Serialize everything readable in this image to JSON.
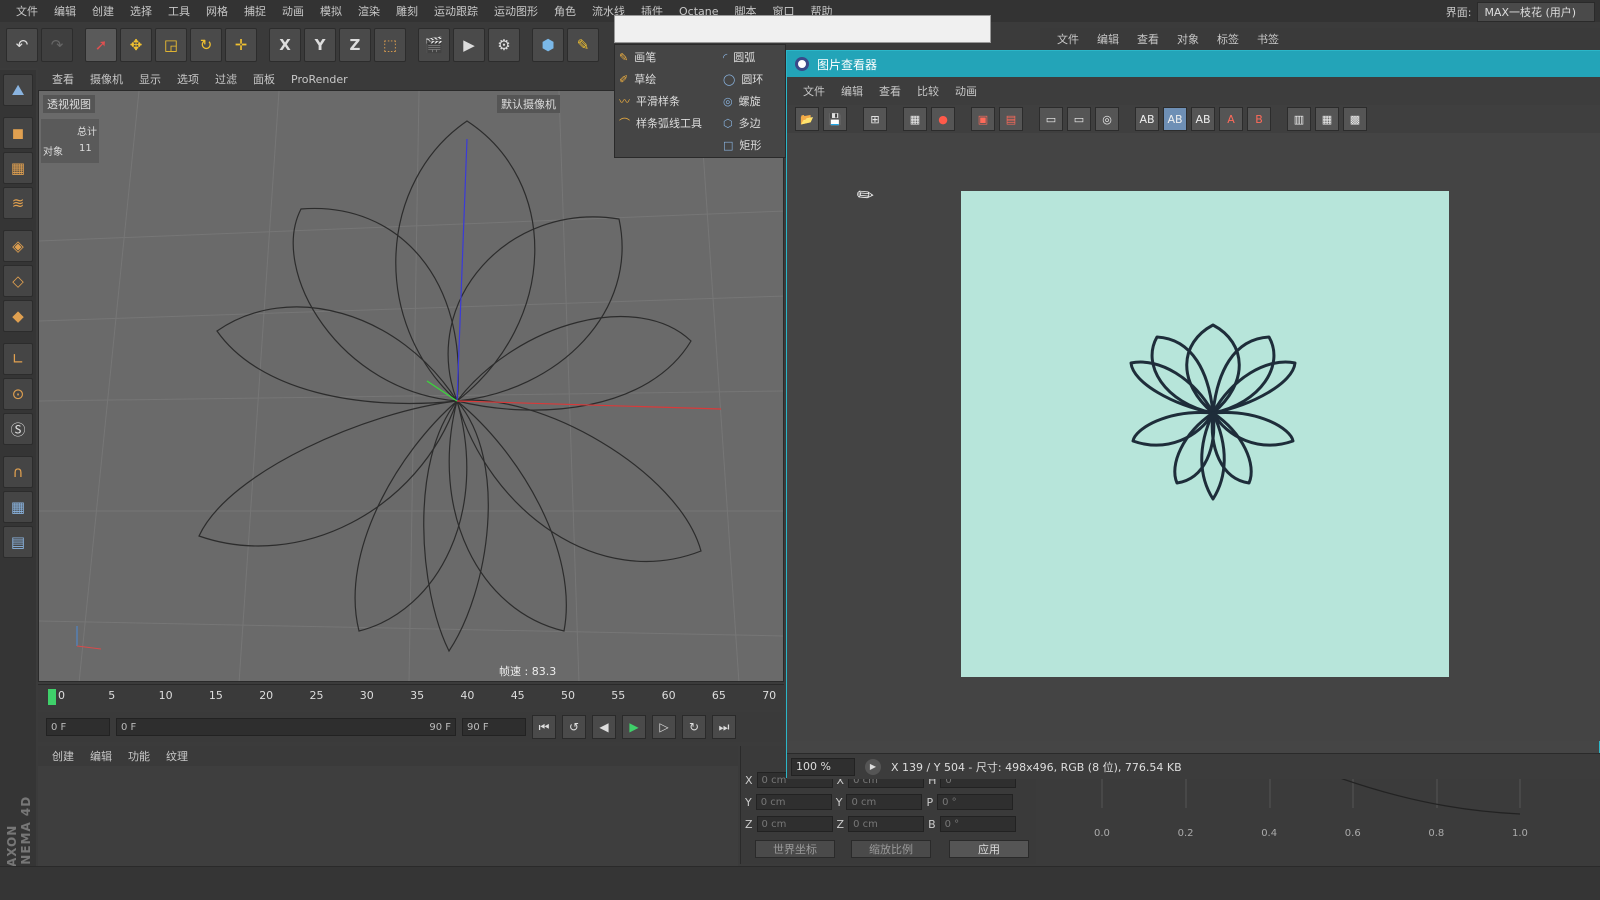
{
  "menubar": {
    "items": [
      "文件",
      "编辑",
      "创建",
      "选择",
      "工具",
      "网格",
      "捕捉",
      "动画",
      "模拟",
      "渲染",
      "雕刻",
      "运动跟踪",
      "运动图形",
      "角色",
      "流水线",
      "插件",
      "Octane",
      "脚本",
      "窗口",
      "帮助"
    ],
    "layout_label": "界面:",
    "layout_value": "MAX一枝花 (用户)"
  },
  "toolbar": {
    "axis_x": "X",
    "axis_y": "Y",
    "axis_z": "Z"
  },
  "viewport": {
    "menu": [
      "查看",
      "摄像机",
      "显示",
      "选项",
      "过滤",
      "面板",
      "ProRender"
    ],
    "label": "透视视图",
    "camera": "默认摄像机",
    "stats_total": "总计",
    "stats_objects_label": "对象",
    "stats_objects_value": "11",
    "speed": "帧速 : 83.3"
  },
  "spline_menu": {
    "left": [
      "画笔",
      "草绘",
      "平滑样条",
      "样条弧线工具"
    ],
    "right": [
      "圆弧",
      "圆环",
      "螺旋",
      "多边",
      "矩形"
    ]
  },
  "timeline": {
    "ticks": [
      "0",
      "5",
      "10",
      "15",
      "20",
      "25",
      "30",
      "35",
      "40",
      "45",
      "50",
      "55",
      "60",
      "65",
      "70"
    ],
    "current_frame": "0 F",
    "range_start": "0 F",
    "range_end": "90 F",
    "end_frame": "90 F"
  },
  "material": {
    "menu": [
      "创建",
      "编辑",
      "功能",
      "纹理"
    ]
  },
  "coords": {
    "rows": [
      {
        "a": "X",
        "av": "0 cm",
        "b": "X",
        "bv": "0 cm",
        "c": "H",
        "cv": "0 °"
      },
      {
        "a": "Y",
        "av": "0 cm",
        "b": "Y",
        "bv": "0 cm",
        "c": "P",
        "cv": "0 °"
      },
      {
        "a": "Z",
        "av": "0 cm",
        "b": "Z",
        "bv": "0 cm",
        "c": "B",
        "cv": "0 °"
      }
    ],
    "world": "世界坐标",
    "scale": "缩放比例",
    "apply": "应用"
  },
  "right_panel": {
    "menu": [
      "文件",
      "编辑",
      "查看",
      "对象",
      "标签",
      "书签"
    ],
    "graph_ticks": [
      "0.0",
      "0.2",
      "0.4",
      "0.6",
      "0.8",
      "1.0"
    ]
  },
  "picture_viewer": {
    "title": "图片查看器",
    "menu": [
      "文件",
      "编辑",
      "查看",
      "比较",
      "动画"
    ],
    "zoom": "100 %",
    "status": "X 139 / Y 504 - 尺寸: 498x496, RGB (8 位), 776.54 KB",
    "render_bg": "#b7e5da",
    "flower_stroke": "#1e2d3a"
  },
  "colors": {
    "title_bar": "#23a4b8",
    "frame_marker": "#3fd06a"
  }
}
